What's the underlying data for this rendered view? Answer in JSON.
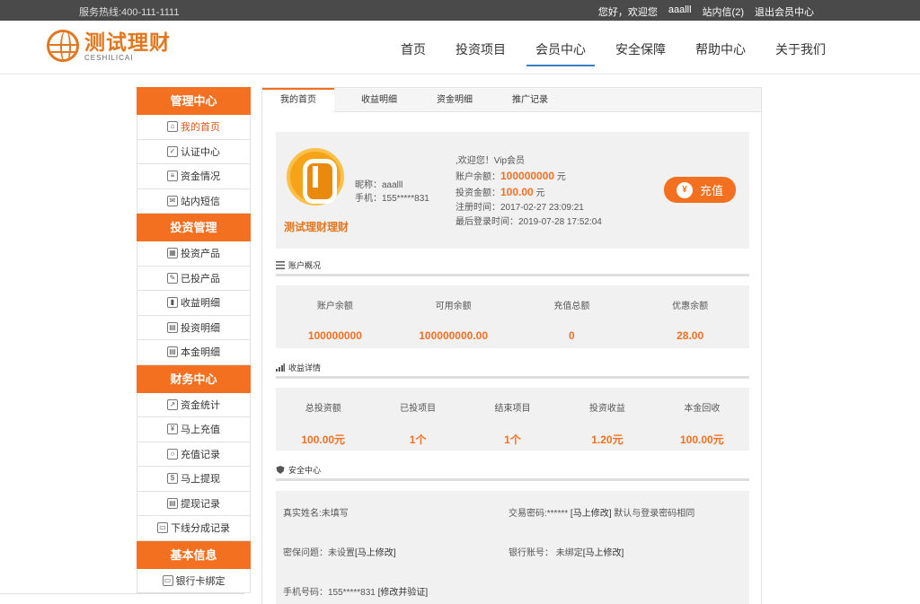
{
  "topbar": {
    "hotline": "服务热线:400-111-1111",
    "greeting": "您好，欢迎您",
    "username": "aaalll",
    "messages": "站内信(2)",
    "logout": "退出会员中心"
  },
  "logo": {
    "cn": "测试理财",
    "en": "CESHILICAI"
  },
  "nav": [
    "首页",
    "投资项目",
    "会员中心",
    "安全保障",
    "帮助中心",
    "关于我们"
  ],
  "sidebar": [
    {
      "head": "管理中心",
      "items": [
        "我的首页",
        "认证中心",
        "资金情况",
        "站内短信"
      ]
    },
    {
      "head": "投资管理",
      "items": [
        "投资产品",
        "已投产品",
        "收益明细",
        "投资明细",
        "本金明细"
      ]
    },
    {
      "head": "财务中心",
      "items": [
        "资金统计",
        "马上充值",
        "充值记录",
        "马上提现",
        "提现记录",
        "下线分成记录"
      ]
    },
    {
      "head": "基本信息",
      "items": [
        "银行卡绑定"
      ]
    }
  ],
  "tabs": [
    "我的首页",
    "收益明细",
    "资金明细",
    "推广记录"
  ],
  "profile": {
    "brand": "测试理财理财",
    "nick_label": "昵称：aaalll",
    "phone_label": "手机：155*****831",
    "welcome": ",欢迎您！Vip会员",
    "balance_label": "账户余额：",
    "balance": "100000000",
    "balance_unit": "元",
    "invest_label": "投资金额：",
    "invest": "100.00",
    "invest_unit": "元",
    "register": "注册时间：2017-02-27 23:09:21",
    "last_login": "最后登录时间：2019-07-28 17:52:04",
    "charge_label": "充值",
    "charge_icon": "¥"
  },
  "account_overview": {
    "title": "账户概况",
    "items": [
      {
        "label": "账户余额",
        "value": "100000000"
      },
      {
        "label": "可用余额",
        "value": "100000000.00"
      },
      {
        "label": "充值总额",
        "value": "0"
      },
      {
        "label": "优惠余额",
        "value": "28.00"
      }
    ]
  },
  "income_detail": {
    "title": "收益详情",
    "items": [
      {
        "label": "总投资额",
        "value": "100.00元"
      },
      {
        "label": "已投项目",
        "value": "1个"
      },
      {
        "label": "结束项目",
        "value": "1个"
      },
      {
        "label": "投资收益",
        "value": "1.20元"
      },
      {
        "label": "本金回收",
        "value": "100.00元"
      }
    ]
  },
  "security": {
    "title": "安全中心",
    "real_name": "真实姓名:未填写",
    "trade_pwd": "交易密码:******",
    "trade_pwd_link": "[马上修改]",
    "trade_pwd_note": "默认与登录密码相同",
    "question": "密保问题：未设置",
    "question_link": "[马上修改]",
    "bank": "银行账号： 未绑定",
    "bank_link": "[马上修改]",
    "phone": "手机号码：155*****831",
    "phone_link": "[修改并验证]"
  },
  "colors": {
    "accent": "#f37021",
    "topbar": "#4a4a4a",
    "nav_underline": "#3a7ec2"
  }
}
